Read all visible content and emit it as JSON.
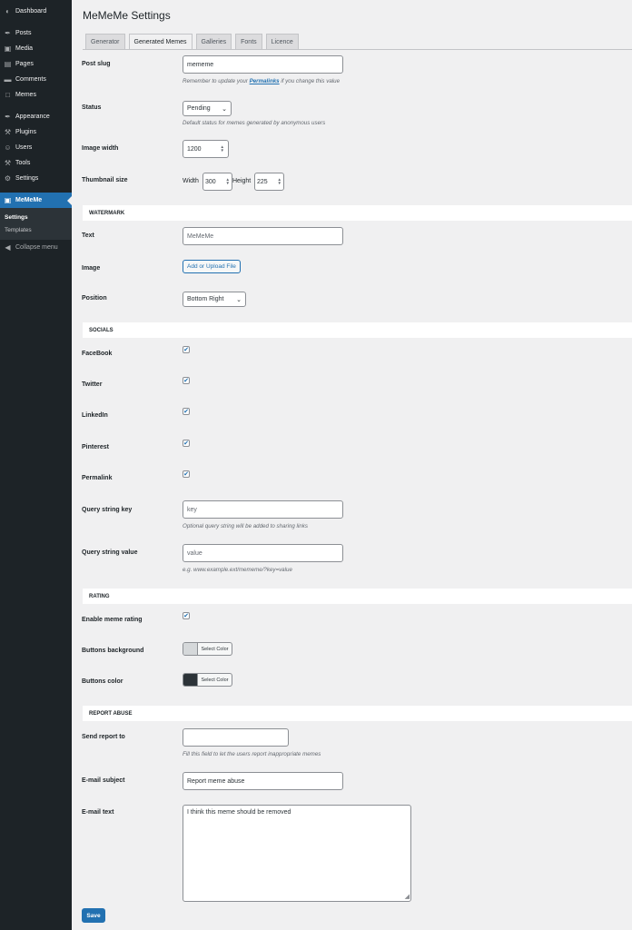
{
  "sidebar": {
    "items": [
      {
        "label": "Dashboard",
        "icon": "◐",
        "name": "dashboard"
      },
      {
        "label": "Posts",
        "icon": "✒",
        "name": "posts"
      },
      {
        "label": "Media",
        "icon": "▣",
        "name": "media"
      },
      {
        "label": "Pages",
        "icon": "▤",
        "name": "pages"
      },
      {
        "label": "Comments",
        "icon": "▬",
        "name": "comments"
      },
      {
        "label": "Memes",
        "icon": "□",
        "name": "memes"
      },
      {
        "label": "Appearance",
        "icon": "✒",
        "name": "appearance"
      },
      {
        "label": "Plugins",
        "icon": "⚒",
        "name": "plugins"
      },
      {
        "label": "Users",
        "icon": "☺",
        "name": "users"
      },
      {
        "label": "Tools",
        "icon": "⚒",
        "name": "tools"
      },
      {
        "label": "Settings",
        "icon": "⚙",
        "name": "settings"
      },
      {
        "label": "MeMeMe",
        "icon": "▣",
        "name": "mememe"
      }
    ],
    "submenu": [
      "Settings",
      "Templates"
    ],
    "collapse_label": "Collapse menu",
    "collapse_icon": "◀"
  },
  "page": {
    "title": "MeMeMe Settings",
    "tabs": [
      "Generator",
      "Generated Memes",
      "Galleries",
      "Fonts",
      "Licence"
    ],
    "active_tab": "Generated Memes"
  },
  "fields": {
    "post_slug": {
      "label": "Post slug",
      "value": "mememe",
      "desc_before": "Remember to update your ",
      "desc_link": "Permalinks",
      "desc_after": " if you change this value"
    },
    "status": {
      "label": "Status",
      "value": "Pending",
      "desc": "Default status for memes generated by anonymous users"
    },
    "image_width": {
      "label": "Image width",
      "value": "1200"
    },
    "thumbnail": {
      "label": "Thumbnail size",
      "width_label": "Width",
      "width_value": "300",
      "height_label": "Height",
      "height_value": "225"
    }
  },
  "watermark": {
    "section": "WATERMARK",
    "text_label": "Text",
    "text_placeholder": "MeMeMe",
    "image_label": "Image",
    "upload_button": "Add or Upload File",
    "position_label": "Position",
    "position_value": "Bottom Right"
  },
  "socials": {
    "section": "SOCIALS",
    "items": [
      {
        "label": "FaceBook",
        "checked": true
      },
      {
        "label": "Twitter",
        "checked": true
      },
      {
        "label": "LinkedIn",
        "checked": true
      },
      {
        "label": "Pinterest",
        "checked": true
      },
      {
        "label": "Permalink",
        "checked": true
      }
    ],
    "qs_key_label": "Query string key",
    "qs_key_placeholder": "key",
    "qs_key_desc": "Optional query string will be added to sharing links",
    "qs_value_label": "Query string value",
    "qs_value_placeholder": "value",
    "qs_value_desc": "e.g. www.example.ext/mememe/?key=value"
  },
  "rating": {
    "section": "RATING",
    "enable_label": "Enable meme rating",
    "enable_checked": true,
    "bg_label": "Buttons background",
    "bg_color": "#d5d8da",
    "color_label": "Buttons color",
    "color_color": "#2c3338",
    "select_color": "Select Color"
  },
  "report": {
    "section": "REPORT ABUSE",
    "send_label": "Send report to",
    "send_value": "",
    "send_desc": "Fill this field to let the users report inappropriate memes",
    "subject_label": "E-mail subject",
    "subject_value": "Report meme abuse",
    "text_label": "E-mail text",
    "text_value": "I think this meme should be removed"
  },
  "save_label": "Save",
  "check_glyph": "✔",
  "colors": {
    "accent": "#2271b1",
    "sidebar": "#1d2327",
    "background": "#f0f0f1"
  }
}
